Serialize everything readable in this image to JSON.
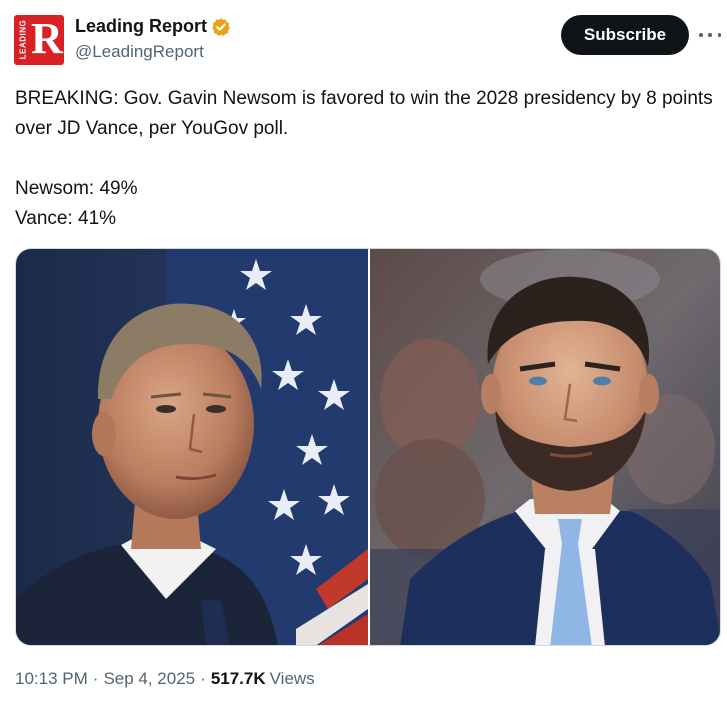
{
  "author": {
    "display_name": "Leading Report",
    "handle": "@LeadingReport",
    "avatar_letter": "R",
    "avatar_side_text": "LEADING",
    "verified": true,
    "brand_color": "#d82027",
    "badge_color": "#e8a317"
  },
  "actions": {
    "subscribe_label": "Subscribe",
    "more_icon": "more-horizontal-icon"
  },
  "tweet": {
    "lines": [
      "BREAKING: Gov. Gavin Newsom is favored to win the 2028 presidency by 8 points over JD Vance, per YouGov poll.",
      "",
      "Newsom: 49%",
      "Vance: 41%"
    ]
  },
  "meta": {
    "time": "10:13 PM",
    "separator": "·",
    "date": "Sep 4, 2025",
    "views_count": "517.7K",
    "views_label": "Views"
  }
}
